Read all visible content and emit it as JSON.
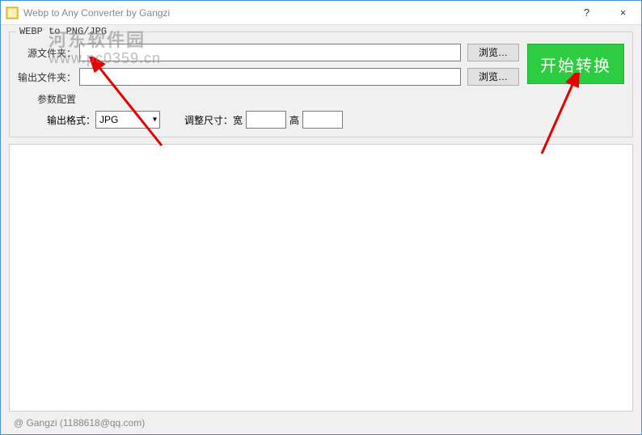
{
  "window": {
    "title": "Webp to Any Converter by Gangzi",
    "help": "?",
    "close": "×"
  },
  "groupbox": {
    "title": "WEBP to PNG/JPG"
  },
  "source": {
    "label": "源文件夹：",
    "value": "",
    "browse": "浏览…"
  },
  "output": {
    "label": "输出文件夹：",
    "value": "",
    "browse": "浏览…"
  },
  "start": {
    "label": "开始转换"
  },
  "params": {
    "section": "参数配置",
    "format_label": "输出格式：",
    "format_value": "JPG",
    "resize_label": "调整尺寸：宽",
    "width_value": "",
    "height_label": "高",
    "height_value": ""
  },
  "statusbar": {
    "text": "@ Gangzi (1188618@qq.com)"
  },
  "watermark": {
    "line1": "河东软件园",
    "line2": "www.pc0359.cn"
  }
}
